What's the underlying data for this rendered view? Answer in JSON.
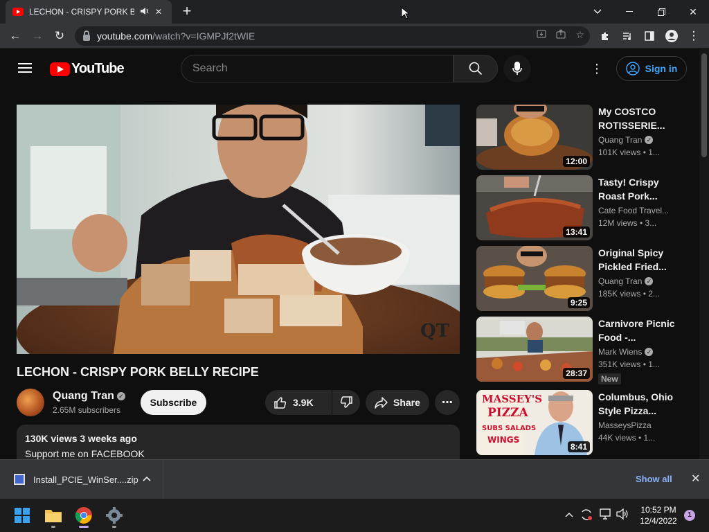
{
  "browser": {
    "tab_title": "LECHON - CRISPY PORK BELLY RECIPE",
    "url_host": "youtube.com",
    "url_rest": "/watch?v=IGMPJf2tWIE"
  },
  "youtube": {
    "logo_text": "YouTube",
    "search_placeholder": "Search",
    "signin_label": "Sign in"
  },
  "video": {
    "title": "LECHON - CRISPY PORK BELLY RECIPE",
    "watermark": "QT",
    "channel": "Quang Tran",
    "subscribers": "2.65M subscribers",
    "subscribe_label": "Subscribe",
    "likes": "3.9K",
    "share_label": "Share",
    "views_and_date": "130K views  3 weeks ago",
    "description": "Support me on FACEBOOK"
  },
  "related": [
    {
      "title": "My COSTCO ROTISSERIE...",
      "channel": "Quang Tran",
      "verified": true,
      "views": "101K views  • 1...",
      "duration": "12:00",
      "badge": ""
    },
    {
      "title": "Tasty!  Crispy Roast Pork...",
      "channel": "Cate Food Travel...",
      "verified": false,
      "views": "12M views  • 3...",
      "duration": "13:41",
      "badge": ""
    },
    {
      "title": "Original Spicy Pickled Fried...",
      "channel": "Quang Tran",
      "verified": true,
      "views": "185K views  • 2...",
      "duration": "9:25",
      "badge": ""
    },
    {
      "title": "Carnivore Picnic Food -...",
      "channel": "Mark Wiens",
      "verified": true,
      "views": "351K views  • 1...",
      "duration": "28:37",
      "badge": "New"
    },
    {
      "title": "Columbus, Ohio Style Pizza...",
      "channel": "MasseysPizza",
      "verified": false,
      "views": "44K views  • 1...",
      "duration": "8:41",
      "badge": ""
    }
  ],
  "thumb_text": {
    "massey_line1": "MASSEY'S",
    "massey_line2": "PIZZA",
    "massey_line3": "SUBS SALADS",
    "massey_line4": "WINGS"
  },
  "downloads": {
    "file_name": "Install_PCIE_WinSer....zip",
    "show_all_label": "Show all"
  },
  "taskbar": {
    "time": "10:52 PM",
    "date": "12/4/2022",
    "notification_count": "1"
  }
}
